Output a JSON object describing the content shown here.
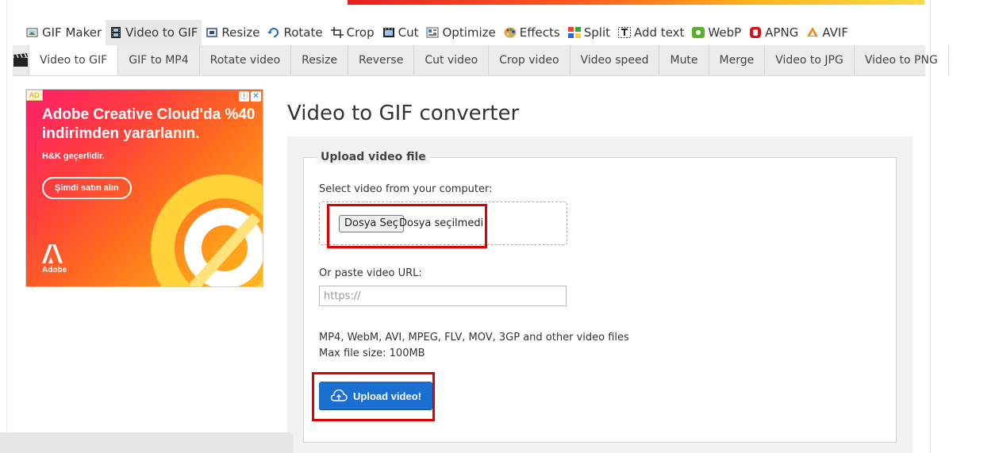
{
  "main_nav": [
    {
      "label": "GIF Maker",
      "icon": "gif-maker-icon",
      "active": false
    },
    {
      "label": "Video to GIF",
      "icon": "film-icon",
      "active": true
    },
    {
      "label": "Resize",
      "icon": "resize-icon",
      "active": false
    },
    {
      "label": "Rotate",
      "icon": "rotate-icon",
      "active": false
    },
    {
      "label": "Crop",
      "icon": "crop-icon",
      "active": false
    },
    {
      "label": "Cut",
      "icon": "cut-icon",
      "active": false
    },
    {
      "label": "Optimize",
      "icon": "optimize-icon",
      "active": false
    },
    {
      "label": "Effects",
      "icon": "palette-icon",
      "active": false
    },
    {
      "label": "Split",
      "icon": "split-icon",
      "active": false
    },
    {
      "label": "Add text",
      "icon": "text-icon",
      "active": false
    },
    {
      "label": "WebP",
      "icon": "webp-icon",
      "active": false
    },
    {
      "label": "APNG",
      "icon": "apng-icon",
      "active": false
    },
    {
      "label": "AVIF",
      "icon": "avif-icon",
      "active": false
    }
  ],
  "sub_nav": [
    {
      "label": "Video to GIF",
      "active": true
    },
    {
      "label": "GIF to MP4",
      "active": false
    },
    {
      "label": "Rotate video",
      "active": false
    },
    {
      "label": "Resize",
      "active": false
    },
    {
      "label": "Reverse",
      "active": false
    },
    {
      "label": "Cut video",
      "active": false
    },
    {
      "label": "Crop video",
      "active": false
    },
    {
      "label": "Video speed",
      "active": false
    },
    {
      "label": "Mute",
      "active": false
    },
    {
      "label": "Merge",
      "active": false
    },
    {
      "label": "Video to JPG",
      "active": false
    },
    {
      "label": "Video to PNG",
      "active": false
    }
  ],
  "ad": {
    "badge": "AD",
    "headline": "Adobe Creative Cloud'da %40 indirimden yararlanın.",
    "subtext": "H&K geçerlidir.",
    "cta": "Şimdi satın alın",
    "brand": "Adobe"
  },
  "page": {
    "title": "Video to GIF converter",
    "legend": "Upload video file",
    "select_label": "Select video from your computer:",
    "file_button": "Dosya Seç",
    "file_status": "Dosya seçilmedi",
    "url_label": "Or paste video URL:",
    "url_placeholder": "https://",
    "formats_text": "MP4, WebM, AVI, MPEG, FLV, MOV, 3GP and other video files",
    "max_size_text": "Max file size: 100MB",
    "upload_button": "Upload video!"
  },
  "colors": {
    "accent": "#1a6fd1",
    "highlight": "#e00000"
  }
}
